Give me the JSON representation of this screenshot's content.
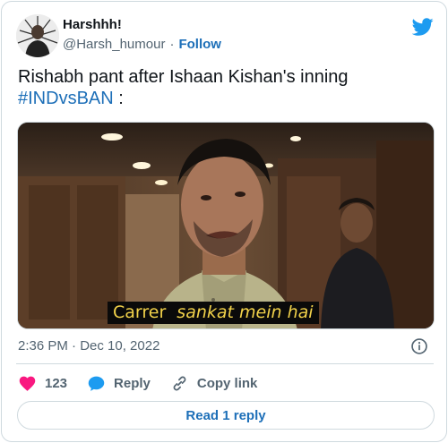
{
  "author": {
    "display_name": "Harshhh!",
    "handle": "@Harsh_humour",
    "separator": "·",
    "follow_label": "Follow"
  },
  "tweet": {
    "text_before": "Rishabh pant after Ishaan Kishan's inning",
    "hashtag": "#INDvsBAN",
    "text_after": " :"
  },
  "media": {
    "subtitle_word1": "Carrer",
    "subtitle_word2": "sankat mein hai"
  },
  "meta": {
    "timestamp": "2:36 PM · Dec 10, 2022"
  },
  "actions": {
    "like_count": "123",
    "reply_label": "Reply",
    "copy_link_label": "Copy link"
  },
  "read_replies_label": "Read 1 reply",
  "colors": {
    "like": "#f91880",
    "reply_icon": "#1d9bf0",
    "link": "#1d6fb8",
    "twitter_brand": "#1d9bf0",
    "subtitle_text": "#f2d24a"
  }
}
